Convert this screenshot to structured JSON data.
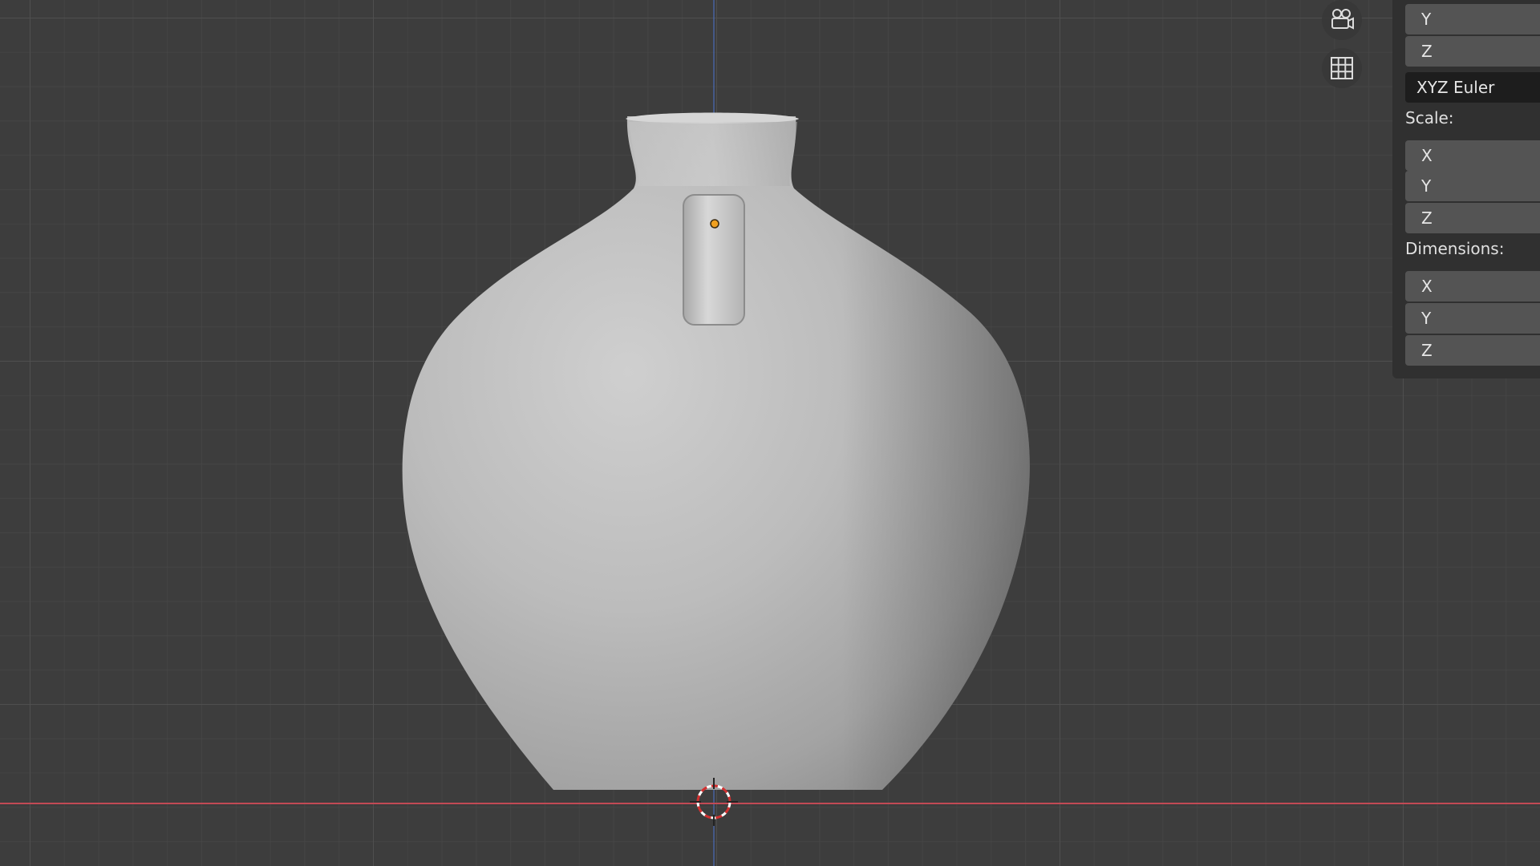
{
  "panel": {
    "rotation": {
      "y_label": "Y",
      "z_label": "Z",
      "mode": "XYZ Euler"
    },
    "scale": {
      "title": "Scale:",
      "x_label": "X",
      "y_label": "Y",
      "z_label": "Z"
    },
    "dimensions": {
      "title": "Dimensions:",
      "x_label": "X",
      "y_label": "Y",
      "z_label": "Z"
    }
  },
  "gizmo": {
    "camera_icon": "camera-view-icon",
    "grid_icon": "ortho-grid-icon"
  },
  "colors": {
    "viewport_bg": "#3d3d3d",
    "x_axis": "#c24a55",
    "z_axis": "#4a6fc2",
    "mesh": "#bdbdbd",
    "origin_dot": "#f0a020",
    "panel_bg": "#303030",
    "field_bg": "#545454"
  }
}
